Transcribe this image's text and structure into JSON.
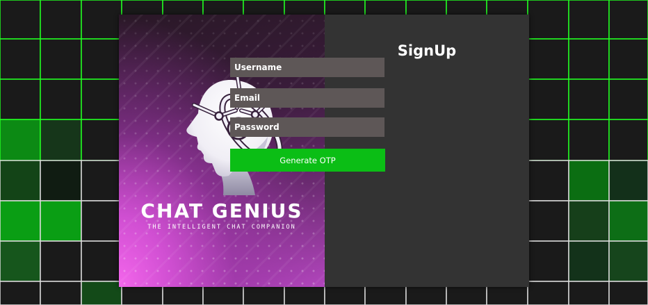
{
  "colors": {
    "background": "#0c0c0c",
    "grid_line_green": "#21ff21",
    "grid_line_white": "#dcdcdc",
    "panel": "#333333",
    "input_fill": "#5e5757",
    "button": "#0bbe15"
  },
  "brand": {
    "name": "CHAT GENIUS",
    "tagline": "THE INTELLIGENT CHAT COMPANION",
    "logo_icon": "robot-head-icon"
  },
  "form": {
    "title": "SignUp",
    "fields": {
      "username": {
        "placeholder": "Username",
        "value": ""
      },
      "email": {
        "placeholder": "Email",
        "value": ""
      },
      "password": {
        "placeholder": "Password",
        "value": ""
      }
    },
    "submit_label": "Generate OTP"
  }
}
